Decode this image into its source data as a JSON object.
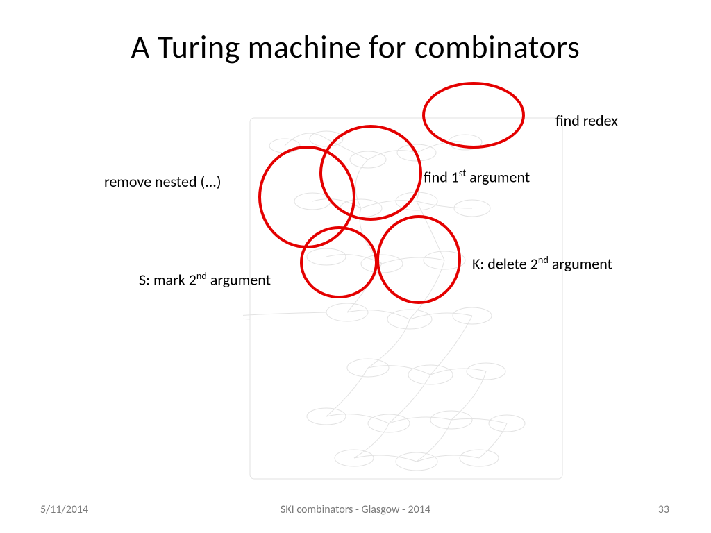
{
  "title": "A Turing machine for combinators",
  "labels": {
    "find_redex": "find redex",
    "find_first_arg": "find 1<sup>st</sup> argument",
    "remove_nested": "remove nested (...)",
    "k_delete": "K: delete 2<sup>nd</sup> argument",
    "s_mark": "S: mark 2<sup>nd</sup> argument"
  },
  "footer": {
    "date": "5/11/2014",
    "center": "SKI combinators - Glasgow - 2014",
    "page": "33"
  }
}
